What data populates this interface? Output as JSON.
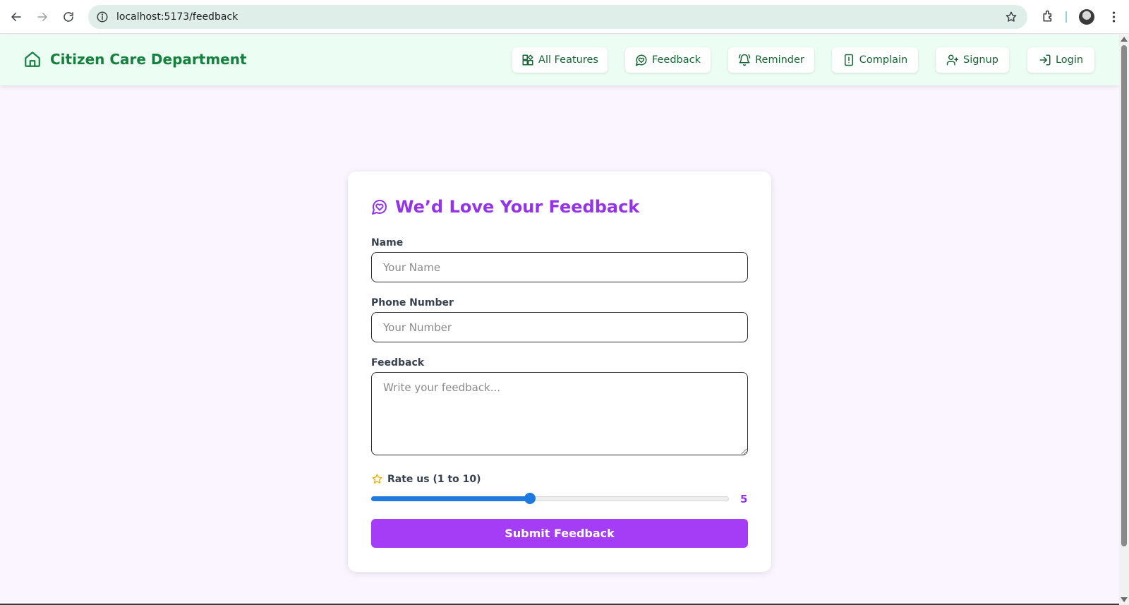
{
  "browser": {
    "url": "localhost:5173/feedback",
    "icons": [
      "back-arrow-icon",
      "forward-arrow-icon",
      "reload-icon",
      "site-info-icon",
      "bookmark-star-icon",
      "extensions-icon",
      "profile-avatar",
      "more-menu-icon"
    ]
  },
  "header": {
    "brand_title": "Citizen Care Department",
    "brand_icon": "home-icon",
    "brand_color": "#15803d",
    "background": "#ecfdf3",
    "nav": [
      {
        "label": "All Features",
        "icon": "widgets-icon"
      },
      {
        "label": "Feedback",
        "icon": "message-heart-icon"
      },
      {
        "label": "Reminder",
        "icon": "bell-ring-icon"
      },
      {
        "label": "Complain",
        "icon": "file-alert-icon"
      },
      {
        "label": "Signup",
        "icon": "user-plus-icon"
      },
      {
        "label": "Login",
        "icon": "log-in-icon"
      }
    ]
  },
  "form": {
    "title": "We’d Love Your Feedback",
    "title_icon": "message-heart-icon",
    "title_color": "#9333ea",
    "name_label": "Name",
    "name_placeholder": "Your Name",
    "name_value": "",
    "phone_label": "Phone Number",
    "phone_placeholder": "Your Number",
    "phone_value": "",
    "feedback_label": "Feedback",
    "feedback_placeholder": "Write your feedback...",
    "feedback_value": "",
    "rate_label": "Rate us (1 to 10)",
    "rate_icon": "star-outline-icon",
    "rate_min": 1,
    "rate_max": 10,
    "rate_value": 5,
    "rate_value_text": "5",
    "submit_label": "Submit Feedback",
    "submit_color": "#a53df7"
  }
}
